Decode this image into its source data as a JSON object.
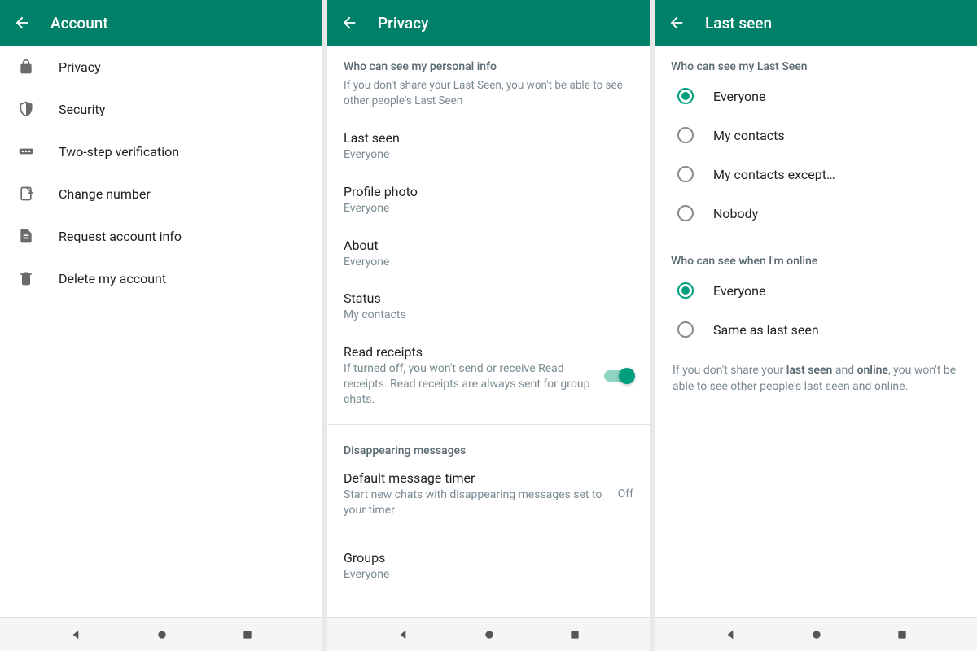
{
  "panel1": {
    "title": "Account",
    "items": [
      {
        "label": "Privacy",
        "icon": "lock-icon"
      },
      {
        "label": "Security",
        "icon": "shield-icon"
      },
      {
        "label": "Two-step verification",
        "icon": "password-icon"
      },
      {
        "label": "Change number",
        "icon": "sim-icon"
      },
      {
        "label": "Request account info",
        "icon": "document-icon"
      },
      {
        "label": "Delete my account",
        "icon": "trash-icon"
      }
    ]
  },
  "panel2": {
    "title": "Privacy",
    "section1_header": "Who can see my personal info",
    "section1_sub": "If you don't share your Last Seen, you won't be able to see other people's Last Seen",
    "lastseen_title": "Last seen",
    "lastseen_value": "Everyone",
    "photo_title": "Profile photo",
    "photo_value": "Everyone",
    "about_title": "About",
    "about_value": "Everyone",
    "status_title": "Status",
    "status_value": "My contacts",
    "receipts_title": "Read receipts",
    "receipts_sub": "If turned off, you won't send or receive Read receipts. Read receipts are always sent for group chats.",
    "section2_header": "Disappearing messages",
    "timer_title": "Default message timer",
    "timer_sub": "Start new chats with disappearing messages set to your timer",
    "timer_value": "Off",
    "groups_title": "Groups",
    "groups_value": "Everyone"
  },
  "panel3": {
    "title": "Last seen",
    "section1_header": "Who can see my Last Seen",
    "options1": [
      {
        "label": "Everyone",
        "selected": true
      },
      {
        "label": "My contacts",
        "selected": false
      },
      {
        "label": "My contacts except…",
        "selected": false
      },
      {
        "label": "Nobody",
        "selected": false
      }
    ],
    "section2_header": "Who can see when I'm online",
    "options2": [
      {
        "label": "Everyone",
        "selected": true
      },
      {
        "label": "Same as last seen",
        "selected": false
      }
    ],
    "note_pre": "If you don't share your ",
    "note_bold1": "last seen",
    "note_mid": " and ",
    "note_bold2": "online",
    "note_post": ", you won't be able to see other people's last seen and online."
  }
}
